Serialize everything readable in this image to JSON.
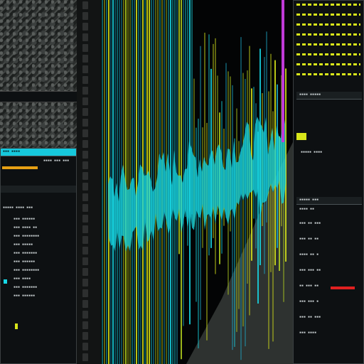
{
  "left_panel": {
    "title": "▪▪▪ ▪▪▪▪",
    "status": "▪▪▪▪ ▪▪▪ ▪▪▪",
    "list_header": "▪▪▪▪▪ ▪▪▪▪ ▪▪▪",
    "rows": [
      "▪▪▪ ▪▪▪▪▪▪",
      "▪▪▪ ▪▪▪▪ ▪▪",
      "▪▪▪ ▪▪▪▪▪▪▪▪",
      "▪▪▪ ▪▪▪▪▪",
      "▪▪▪ ▪▪▪▪▪▪▪",
      "▪▪▪ ▪▪▪▪▪▪",
      "▪▪▪ ▪▪▪▪▪▪▪▪",
      "▪▪▪ ▪▪▪▪",
      "▪▪▪ ▪▪▪▪▪▪▪",
      "▪▪▪ ▪▪▪▪▪▪"
    ]
  },
  "right_panel": {
    "section1_title": "▪▪▪▪ ▪▪▪▪▪",
    "section2_title": "▪▪▪▪▪ ▪▪▪▪",
    "section3_title": "▪▪▪▪▪ ▪▪▪",
    "section3_sub": "▪▪▪▪ ▪▪",
    "rows": [
      "▪▪▪ ▪▪ ▪▪▪",
      "▪▪▪ ▪▪ ▪▪",
      "▪▪▪▪ ▪▪ ▪",
      "▪▪▪ ▪▪▪ ▪▪",
      "▪▪ ▪▪▪ ▪▪",
      "▪▪▪ ▪▪▪ ▪",
      "▪▪▪ ▪▪ ▪▪▪",
      "▪▪▪ ▪▪▪▪"
    ]
  },
  "colors": {
    "cyan": "#17d8e6",
    "yellow": "#d8e61a",
    "magenta": "#c03ad8",
    "red": "#e02020"
  }
}
